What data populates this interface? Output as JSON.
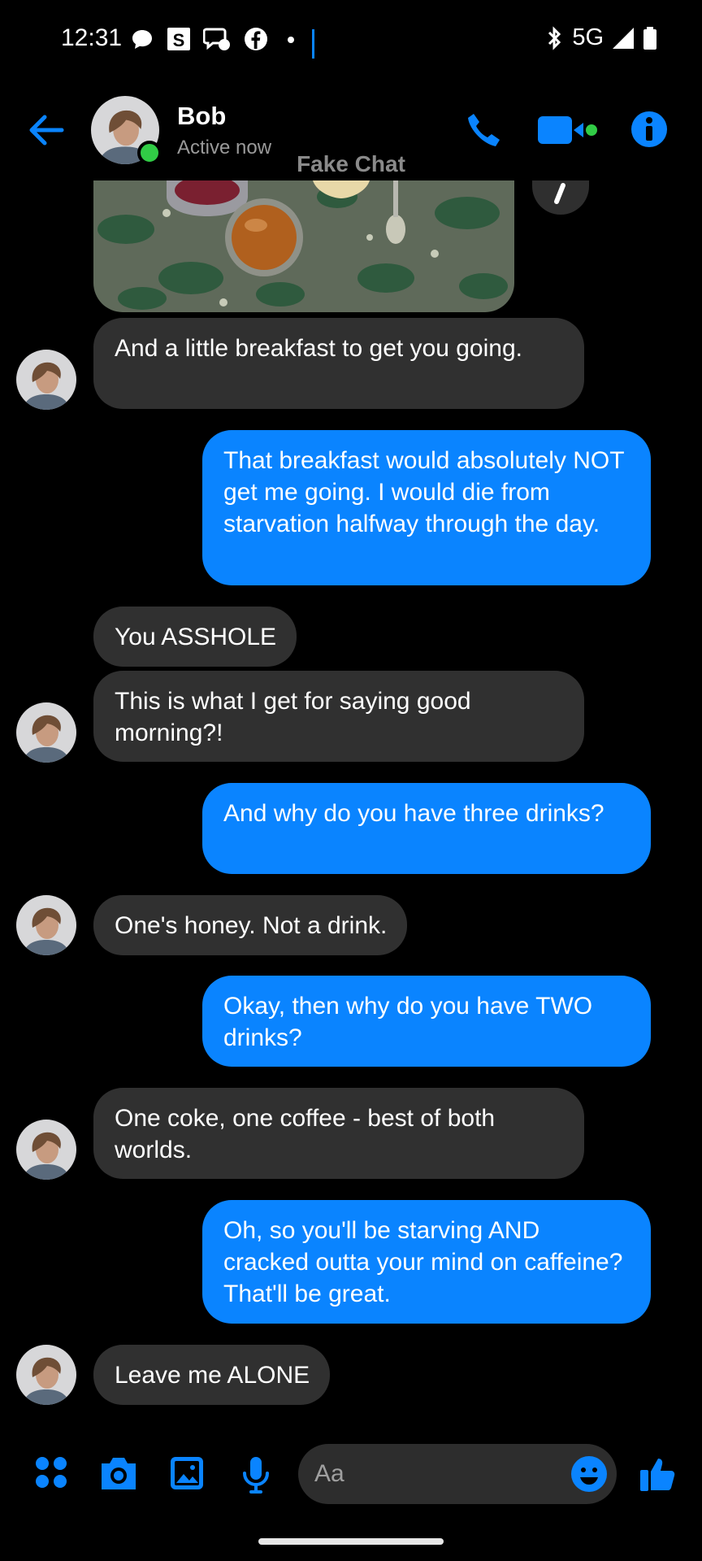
{
  "status_bar": {
    "time": "12:31",
    "network": "5G"
  },
  "header": {
    "contact_name": "Bob",
    "contact_status": "Active now",
    "watermark": "Fake Chat"
  },
  "messages": [
    {
      "from": "contact",
      "text": "And a little breakfast to get you going."
    },
    {
      "from": "me",
      "text": "That breakfast would absolutely NOT get me going. I would die from starvation halfway through the day."
    },
    {
      "from": "contact",
      "text": "You ASSHOLE"
    },
    {
      "from": "contact",
      "text": "This is what I get for saying good morning?!"
    },
    {
      "from": "me",
      "text": "And why do you have three drinks?"
    },
    {
      "from": "contact",
      "text": "One's honey. Not a drink."
    },
    {
      "from": "me",
      "text": "Okay, then why do you have TWO drinks?"
    },
    {
      "from": "contact",
      "text": "One coke, one coffee - best of both worlds."
    },
    {
      "from": "me",
      "text": "Oh, so you'll be starving AND cracked outta your mind on caffeine? That'll be great."
    },
    {
      "from": "contact",
      "text": "Leave me ALONE"
    }
  ],
  "composer": {
    "placeholder": "Aa"
  },
  "colors": {
    "accent": "#0a84ff",
    "incoming_bubble": "#303030",
    "online": "#31cc46",
    "background": "#000000"
  },
  "icons": [
    "back-arrow-icon",
    "phone-icon",
    "video-camera-icon",
    "info-icon",
    "apps-grid-icon",
    "camera-icon",
    "gallery-icon",
    "microphone-icon",
    "emoji-icon",
    "thumbs-up-icon"
  ]
}
